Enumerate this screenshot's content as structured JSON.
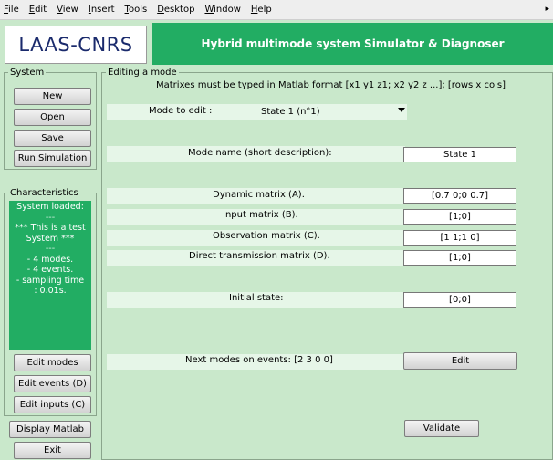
{
  "menubar": {
    "items": [
      {
        "label": "File",
        "underline": "F",
        "rest": "ile"
      },
      {
        "label": "Edit",
        "underline": "E",
        "rest": "dit"
      },
      {
        "label": "View",
        "underline": "V",
        "rest": "iew"
      },
      {
        "label": "Insert",
        "underline": "I",
        "rest": "nsert"
      },
      {
        "label": "Tools",
        "underline": "T",
        "rest": "ools"
      },
      {
        "label": "Desktop",
        "underline": "D",
        "rest": "esktop"
      },
      {
        "label": "Window",
        "underline": "W",
        "rest": "indow"
      },
      {
        "label": "Help",
        "underline": "H",
        "rest": "elp"
      }
    ]
  },
  "header": {
    "logo_text": "LAAS-CNRS",
    "title": "Hybrid multimode system Simulator & Diagnoser"
  },
  "system_panel": {
    "legend": "System",
    "buttons": {
      "new": "New",
      "open": "Open",
      "save": "Save",
      "run": "Run Simulation"
    }
  },
  "characteristics_panel": {
    "legend": "Characteristics",
    "lines": [
      "System loaded:",
      "---",
      "*** This is a test",
      "System ***",
      "---",
      "- 4 modes.",
      "- 4 events.",
      "- sampling time",
      ": 0.01s."
    ],
    "buttons": {
      "edit_modes": "Edit modes",
      "edit_events": "Edit events (D)",
      "edit_inputs": "Edit inputs (C)"
    }
  },
  "bottom_buttons": {
    "display_matlab": "Display Matlab",
    "exit": "Exit"
  },
  "editing": {
    "legend": "Editing a mode",
    "note": "Matrixes must be typed in Matlab format [x1 y1 z1; x2 y2 z ...]; [rows x cols]",
    "mode_to_edit_label": "Mode to edit :",
    "mode_selected": "State 1 (n°1)",
    "mode_name_label": "Mode name (short description):",
    "mode_name_value": "State 1",
    "dynamic_label": "Dynamic matrix (A).",
    "dynamic_value": "[0.7 0;0 0.7]",
    "input_label": "Input matrix (B).",
    "input_value": "[1;0]",
    "observation_label": "Observation matrix (C).",
    "observation_value": "[1 1;1 0]",
    "direct_label": "Direct transmission matrix (D).",
    "direct_value": "[1;0]",
    "initial_label": "Initial state:",
    "initial_value": "[0;0]",
    "next_modes_label": "Next modes on events: [2 3 0 0]",
    "edit_button": "Edit",
    "validate_button": "Validate"
  },
  "colors": {
    "accent_green": "#22ad63",
    "background": "#c9e8cb"
  }
}
